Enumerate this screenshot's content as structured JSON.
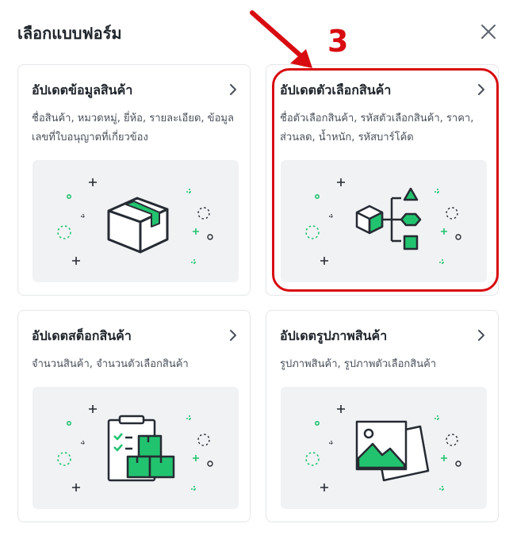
{
  "modal": {
    "title": "เลือกแบบฟอร์ม",
    "close_icon": "close-icon"
  },
  "cards": [
    {
      "title": "อัปเดตข้อมูลสินค้า",
      "description": "ชื่อสินค้า, หมวดหมู่, ยี่ห้อ, รายละเอียด, ข้อมูลเลขที่ใบอนุญาตที่เกี่ยวข้อง",
      "icon": "package-box-icon"
    },
    {
      "title": "อัปเดตตัวเลือกสินค้า",
      "description": "ชื่อตัวเลือกสินค้า, รหัสตัวเลือกสินค้า, ราคา, ส่วนลด, น้ำหนัก, รหัสบาร์โค้ด",
      "icon": "product-variants-icon"
    },
    {
      "title": "อัปเดตสต็อกสินค้า",
      "description": "จำนวนสินค้า, จำนวนตัวเลือกสินค้า",
      "icon": "stock-clipboard-icon"
    },
    {
      "title": "อัปเดตรูปภาพสินค้า",
      "description": "รูปภาพสินค้า, รูปภาพตัวเลือกสินค้า",
      "icon": "product-image-icon"
    }
  ],
  "annotation": {
    "step_number": "3",
    "color": "#d80c10"
  },
  "colors": {
    "accent": "#22c36f",
    "dark": "#262b33",
    "illustration_bg": "#f1f2f4"
  }
}
